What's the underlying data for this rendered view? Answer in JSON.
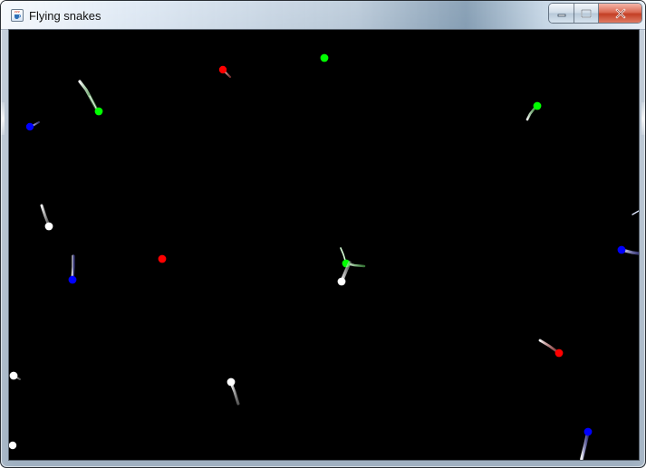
{
  "window": {
    "title": "Flying snakes",
    "icon": "java-coffee-cup-icon",
    "controls": [
      {
        "name": "minimize",
        "icon": "minimize-icon"
      },
      {
        "name": "maximize",
        "icon": "maximize-icon"
      },
      {
        "name": "close",
        "icon": "close-icon"
      }
    ]
  },
  "colors": {
    "background": "#000000",
    "red": "#ff0000",
    "green": "#00ff00",
    "blue": "#0000ff",
    "white": "#ffffff"
  },
  "scene": {
    "type": "flying-snakes-canvas",
    "snake_colors": [
      "red",
      "green",
      "blue",
      "white"
    ]
  }
}
